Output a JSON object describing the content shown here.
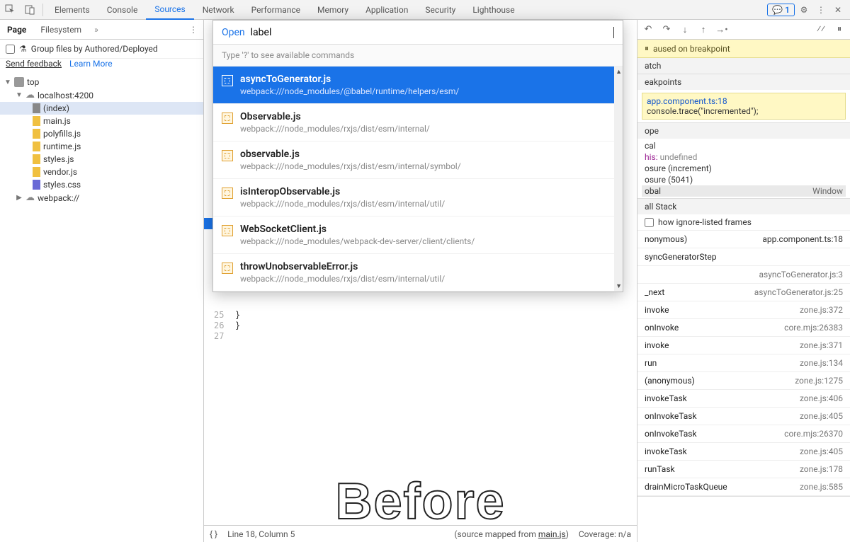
{
  "topTabs": [
    "Elements",
    "Console",
    "Sources",
    "Network",
    "Performance",
    "Memory",
    "Application",
    "Security",
    "Lighthouse"
  ],
  "activeTopTab": "Sources",
  "msgCount": "1",
  "leftTabs": {
    "page": "Page",
    "filesystem": "Filesystem"
  },
  "groupLabel": "Group files by Authored/Deployed",
  "feedback": {
    "send": "Send feedback",
    "learn": "Learn More"
  },
  "tree": {
    "top": "top",
    "host": "localhost:4200",
    "files": [
      "(index)",
      "main.js",
      "polyfills.js",
      "runtime.js",
      "styles.js",
      "vendor.js",
      "styles.css"
    ],
    "webpack": "webpack://"
  },
  "popup": {
    "openLabel": "Open",
    "query": "label",
    "hint": "Type '?' to see available commands",
    "results": [
      {
        "name": "asyncToGenerator.js",
        "path": "webpack:///node_modules/@babel/runtime/helpers/esm/",
        "selected": true,
        "hlRanges": [
          0
        ]
      },
      {
        "name": "Observable.js",
        "path": "webpack:///node_modules/rxjs/dist/esm/internal/"
      },
      {
        "name": "observable.js",
        "path": "webpack:///node_modules/rxjs/dist/esm/internal/symbol/"
      },
      {
        "name": "isInteropObservable.js",
        "path": "webpack:///node_modules/rxjs/dist/esm/internal/util/"
      },
      {
        "name": "WebSocketClient.js",
        "path": "webpack:///node_modules/webpack-dev-server/client/clients/"
      },
      {
        "name": "throwUnobservableError.js",
        "path": "webpack:///node_modules/rxjs/dist/esm/internal/util/"
      }
    ]
  },
  "code": {
    "lines": [
      {
        "n": "25",
        "t": "  }"
      },
      {
        "n": "26",
        "t": "}"
      },
      {
        "n": "27",
        "t": ""
      }
    ]
  },
  "overlayText": "Before",
  "status": {
    "cursor": "Line 18, Column 5",
    "mapped": "(source mapped from ",
    "mapfile": "main.js",
    "mapend": ")",
    "coverage": "Coverage: n/a"
  },
  "paused": "aused on breakpoint",
  "sections": {
    "watch": "atch",
    "breakpoints": "eakpoints",
    "scope": "ope",
    "call": "all Stack"
  },
  "breakpoint": {
    "file": "app.component.ts:18",
    "code": "console.trace(\"incremented\");"
  },
  "scope": {
    "local": "cal",
    "thisLabel": "his:",
    "thisVal": "undefined",
    "c1": "osure (increment)",
    "c2": "osure (5041)",
    "global": "obal",
    "globalVal": "Window"
  },
  "ignoreLabel": "how ignore-listed frames",
  "stack": [
    {
      "fn": "nonymous)",
      "loc": "app.component.ts:18"
    },
    {
      "fn": "syncGeneratorStep",
      "loc": ""
    },
    {
      "fn": "",
      "loc": "asyncToGenerator.js:3"
    },
    {
      "fn": "_next",
      "loc": "asyncToGenerator.js:25"
    },
    {
      "fn": "invoke",
      "loc": "zone.js:372"
    },
    {
      "fn": "onInvoke",
      "loc": "core.mjs:26383"
    },
    {
      "fn": "invoke",
      "loc": "zone.js:371"
    },
    {
      "fn": "run",
      "loc": "zone.js:134"
    },
    {
      "fn": "(anonymous)",
      "loc": "zone.js:1275"
    },
    {
      "fn": "invokeTask",
      "loc": "zone.js:406"
    },
    {
      "fn": "onInvokeTask",
      "loc": "zone.js:405"
    },
    {
      "fn": "onInvokeTask",
      "loc": "core.mjs:26370"
    },
    {
      "fn": "invokeTask",
      "loc": "zone.js:405"
    },
    {
      "fn": "runTask",
      "loc": "zone.js:178"
    },
    {
      "fn": "drainMicroTaskQueue",
      "loc": "zone.js:585"
    }
  ]
}
